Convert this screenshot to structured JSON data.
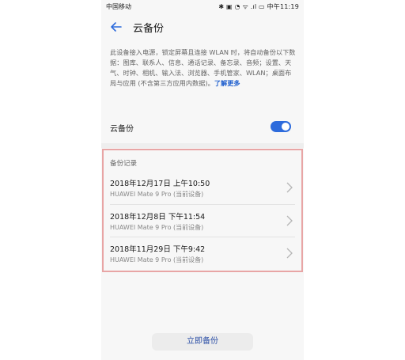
{
  "status": {
    "carrier": "中国移动",
    "right": "✱ ▣ ◔ ᯤ .ıl ▭ 中午11:19"
  },
  "header": {
    "title": "云备份"
  },
  "description": {
    "text": "此设备接入电源，锁定屏幕且连接 WLAN 时，将自动备份以下数据：图库、联系人、信息、通话记录、备忘录、音频；设置、天气、时钟、相机、输入法、浏览器、手机管家、WLAN；桌面布局与应用 (不含第三方应用内数据)。",
    "more": "了解更多"
  },
  "toggle": {
    "label": "云备份",
    "state": "on"
  },
  "records": {
    "title": "备份记录",
    "items": [
      {
        "date": "2018年12月17日 上午10:50",
        "device": "HUAWEI Mate 9 Pro (当前设备)"
      },
      {
        "date": "2018年12月8日 下午11:54",
        "device": "HUAWEI Mate 9 Pro (当前设备)"
      },
      {
        "date": "2018年11月29日 下午9:42",
        "device": "HUAWEI Mate 9 Pro (当前设备)"
      }
    ]
  },
  "action": {
    "backup_now": "立即备份"
  },
  "colors": {
    "accent": "#2d6bdc",
    "link": "#1f5fce",
    "highlight": "#e8a5a5"
  }
}
